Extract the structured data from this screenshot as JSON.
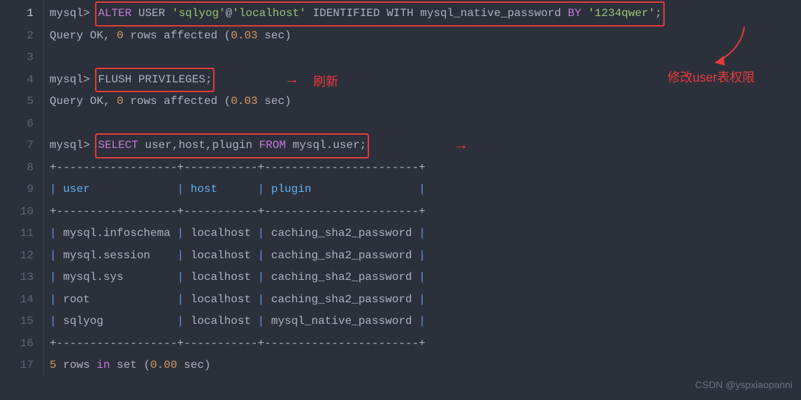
{
  "totalLines": 17,
  "prompt": "mysql>",
  "lines": {
    "l1": {
      "pre": "mysql> ",
      "t1": "ALTER",
      "t2": " USER ",
      "s1": "'sqlyog'",
      "t3": "@",
      "s2": "'localhost'",
      "t4": " IDENTIFIED WITH mysql_native_password ",
      "k1": "BY",
      "t5": " ",
      "s3": "'1234qwer'",
      "t6": ";"
    },
    "l2": {
      "a": "Query OK, ",
      "b": "0",
      "c": " rows affected (",
      "d": "0.03",
      "e": " sec)"
    },
    "l4": {
      "pre": "mysql> ",
      "cmd": "FLUSH PRIVILEGES;"
    },
    "l5": {
      "a": "Query OK, ",
      "b": "0",
      "c": " rows affected (",
      "d": "0.03",
      "e": " sec)"
    },
    "l7": {
      "pre": "mysql> ",
      "k": "SELECT",
      "rest": " user,host,plugin ",
      "k2": "FROM",
      "rest2": " mysql.user;"
    },
    "border": "+------------------+-----------+-----------------------+",
    "header": {
      "p": "| ",
      "user": "user",
      "pad1": "             | ",
      "host": "host",
      "pad2": "      | ",
      "plugin": "plugin",
      "pad3": "                |"
    },
    "rows": [
      {
        "user": "mysql.infoschema",
        "host": "localhost",
        "plugin": "caching_sha2_password"
      },
      {
        "user": "mysql.session",
        "host": "localhost",
        "plugin": "caching_sha2_password"
      },
      {
        "user": "mysql.sys",
        "host": "localhost",
        "plugin": "caching_sha2_password"
      },
      {
        "user": "root",
        "host": "localhost",
        "plugin": "caching_sha2_password"
      },
      {
        "user": "sqlyog",
        "host": "localhost",
        "plugin": "mysql_native_password"
      }
    ],
    "l17": {
      "a": "5",
      "b": " rows ",
      "c": "in",
      "d": " set (",
      "e": "0.00",
      "f": " sec)"
    }
  },
  "annotations": {
    "refresh": "刷新",
    "modifyUser": "修改user表权限"
  },
  "watermark": "CSDN @yspxiaopanni"
}
